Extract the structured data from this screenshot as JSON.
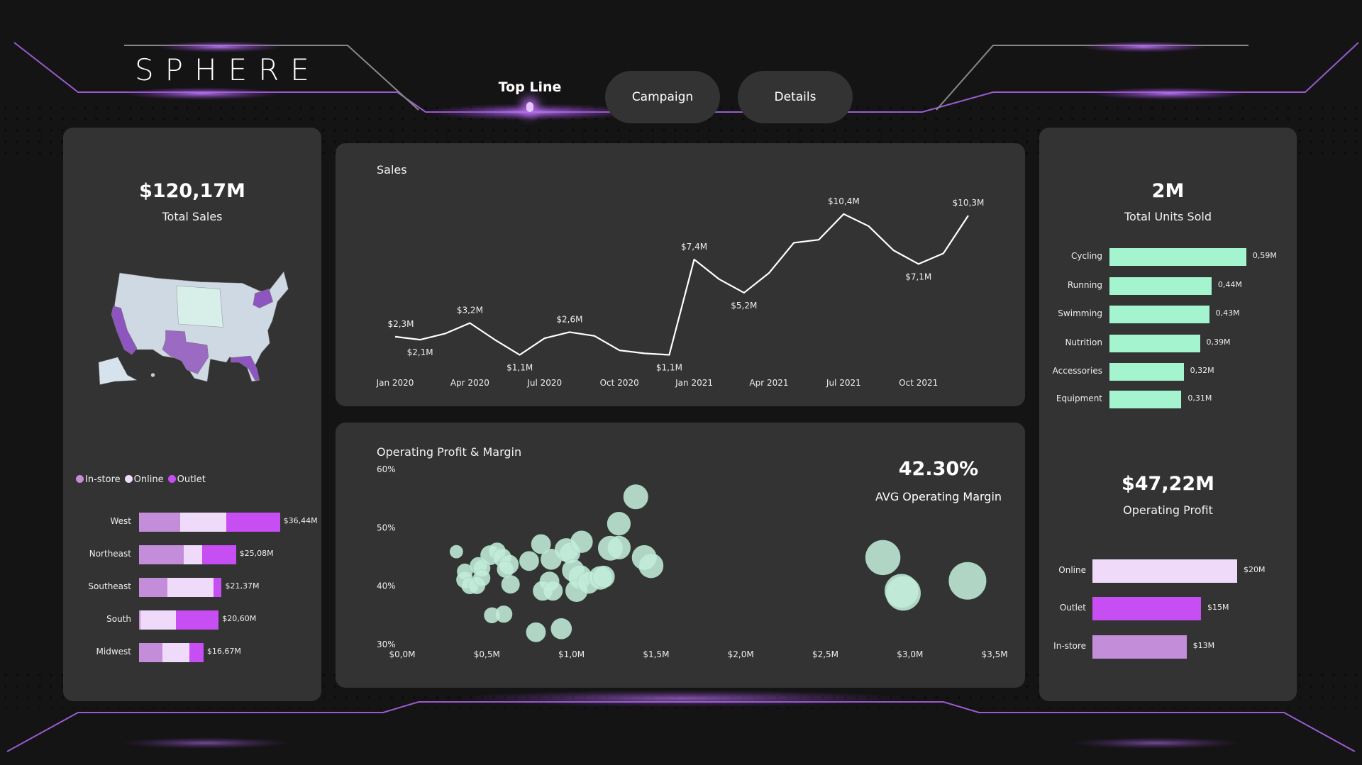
{
  "header": {
    "logo": "SPHERE",
    "tabs": [
      {
        "label": "Top Line",
        "active": true
      },
      {
        "label": "Campaign",
        "active": false
      },
      {
        "label": "Details",
        "active": false
      }
    ]
  },
  "colors": {
    "instore": "#c38dd9",
    "online": "#f0dafa",
    "outlet": "#c74ef2",
    "mint": "#a4f4cf",
    "bubble": "#c2ecd9",
    "purple_state": "#8c55c0"
  },
  "left": {
    "kpi_value": "$120,17M",
    "kpi_label": "Total Sales",
    "legend": [
      "In-store",
      "Online",
      "Outlet"
    ],
    "regions": [
      {
        "name": "West",
        "instore": 10.64,
        "online": 11.92,
        "outlet": 13.88,
        "total_label": "$36,44M"
      },
      {
        "name": "Northeast",
        "instore": 11.62,
        "online": 4.65,
        "outlet": 8.81,
        "total_label": "$25,08M"
      },
      {
        "name": "Southeast",
        "instore": 7.28,
        "online": 12.05,
        "outlet": 2.04,
        "total_label": "$21,37M"
      },
      {
        "name": "South",
        "instore": 0.31,
        "online": 9.23,
        "outlet": 11.06,
        "total_label": "$20,60M"
      },
      {
        "name": "Midwest",
        "instore": 5.99,
        "online": 7.09,
        "outlet": 3.59,
        "total_label": "$16,67M"
      }
    ]
  },
  "chart_data": [
    {
      "type": "line",
      "title": "Sales",
      "x": [
        "Jan 2020",
        "Feb 2020",
        "Mar 2020",
        "Apr 2020",
        "May 2020",
        "Jun 2020",
        "Jul 2020",
        "Aug 2020",
        "Sep 2020",
        "Oct 2020",
        "Nov 2020",
        "Dec 2020",
        "Jan 2021",
        "Feb 2021",
        "Mar 2021",
        "Apr 2021",
        "May 2021",
        "Jun 2021",
        "Jul 2021",
        "Aug 2021",
        "Sep 2021",
        "Oct 2021",
        "Nov 2021",
        "Dec 2021"
      ],
      "values": [
        2.3,
        2.1,
        2.5,
        3.2,
        2.1,
        1.1,
        2.2,
        2.6,
        2.35,
        1.4,
        1.2,
        1.1,
        7.4,
        6.1,
        5.2,
        6.5,
        8.5,
        8.7,
        10.4,
        9.6,
        8.0,
        7.1,
        7.8,
        10.3
      ],
      "unit": "$M",
      "x_ticks": [
        "Jan 2020",
        "Apr 2020",
        "Jul 2020",
        "Oct 2020",
        "Jan 2021",
        "Apr 2021",
        "Jul 2021",
        "Oct 2021"
      ],
      "data_labels": [
        {
          "index": 0,
          "text": "$2,3M",
          "pos": "above"
        },
        {
          "index": 1,
          "text": "$2,1M",
          "pos": "below"
        },
        {
          "index": 3,
          "text": "$3,2M",
          "pos": "above"
        },
        {
          "index": 5,
          "text": "$1,1M",
          "pos": "below"
        },
        {
          "index": 7,
          "text": "$2,6M",
          "pos": "above"
        },
        {
          "index": 11,
          "text": "$1,1M",
          "pos": "below"
        },
        {
          "index": 12,
          "text": "$7,4M",
          "pos": "above"
        },
        {
          "index": 14,
          "text": "$5,2M",
          "pos": "below"
        },
        {
          "index": 18,
          "text": "$10,4M",
          "pos": "above"
        },
        {
          "index": 21,
          "text": "$7,1M",
          "pos": "below"
        },
        {
          "index": 23,
          "text": "$10,3M",
          "pos": "above"
        }
      ],
      "ylim": [
        0,
        11
      ]
    },
    {
      "type": "scatter",
      "title": "Operating Profit & Margin",
      "xlabel": "",
      "ylabel": "",
      "xlim": [
        0,
        3.5
      ],
      "ylim": [
        30,
        60
      ],
      "x_ticks": [
        "$0,0M",
        "$0,5M",
        "$1,0M",
        "$1,5M",
        "$2,0M",
        "$2,5M",
        "$3,0M",
        "$3,5M"
      ],
      "y_ticks": [
        "60%",
        "50%",
        "40%",
        "30%"
      ],
      "points": [
        {
          "x": 0.32,
          "y": 45.9,
          "s": 1
        },
        {
          "x": 0.37,
          "y": 42.5,
          "s": 1.2
        },
        {
          "x": 0.37,
          "y": 41.1,
          "s": 1.3
        },
        {
          "x": 0.4,
          "y": 40.1,
          "s": 1.3
        },
        {
          "x": 0.44,
          "y": 40.1,
          "s": 1.3
        },
        {
          "x": 0.45,
          "y": 43.5,
          "s": 1.3
        },
        {
          "x": 0.47,
          "y": 43.1,
          "s": 1.3
        },
        {
          "x": 0.47,
          "y": 41.4,
          "s": 1.3
        },
        {
          "x": 0.52,
          "y": 45.3,
          "s": 1.5
        },
        {
          "x": 0.56,
          "y": 46.0,
          "s": 1.3
        },
        {
          "x": 0.59,
          "y": 44.9,
          "s": 1.4
        },
        {
          "x": 0.63,
          "y": 43.7,
          "s": 1.5
        },
        {
          "x": 0.61,
          "y": 42.9,
          "s": 1.3
        },
        {
          "x": 0.64,
          "y": 40.3,
          "s": 1.4
        },
        {
          "x": 0.53,
          "y": 35.0,
          "s": 1.2
        },
        {
          "x": 0.6,
          "y": 35.2,
          "s": 1.3
        },
        {
          "x": 0.75,
          "y": 44.3,
          "s": 1.5
        },
        {
          "x": 0.82,
          "y": 47.2,
          "s": 1.5
        },
        {
          "x": 0.88,
          "y": 44.6,
          "s": 1.6
        },
        {
          "x": 0.87,
          "y": 40.8,
          "s": 1.5
        },
        {
          "x": 0.83,
          "y": 39.2,
          "s": 1.5
        },
        {
          "x": 0.89,
          "y": 39.2,
          "s": 1.5
        },
        {
          "x": 0.79,
          "y": 32.1,
          "s": 1.5
        },
        {
          "x": 0.94,
          "y": 32.7,
          "s": 1.6
        },
        {
          "x": 0.97,
          "y": 46.2,
          "s": 1.8
        },
        {
          "x": 0.99,
          "y": 45.7,
          "s": 1.6
        },
        {
          "x": 1.01,
          "y": 42.7,
          "s": 1.7
        },
        {
          "x": 1.06,
          "y": 47.6,
          "s": 1.7
        },
        {
          "x": 1.05,
          "y": 41.6,
          "s": 1.8
        },
        {
          "x": 1.03,
          "y": 39.2,
          "s": 1.7
        },
        {
          "x": 1.1,
          "y": 40.6,
          "s": 1.7
        },
        {
          "x": 1.17,
          "y": 41.4,
          "s": 1.8
        },
        {
          "x": 1.19,
          "y": 41.6,
          "s": 1.7
        },
        {
          "x": 1.23,
          "y": 46.5,
          "s": 1.9
        },
        {
          "x": 1.28,
          "y": 46.6,
          "s": 1.8
        },
        {
          "x": 1.28,
          "y": 50.7,
          "s": 1.8
        },
        {
          "x": 1.38,
          "y": 55.3,
          "s": 1.9
        },
        {
          "x": 1.43,
          "y": 44.9,
          "s": 1.9
        },
        {
          "x": 1.47,
          "y": 43.5,
          "s": 1.9
        },
        {
          "x": 2.84,
          "y": 44.9,
          "s": 2.7
        },
        {
          "x": 2.95,
          "y": 39.2,
          "s": 2.6
        },
        {
          "x": 2.96,
          "y": 38.8,
          "s": 2.7
        },
        {
          "x": 3.34,
          "y": 40.9,
          "s": 2.9
        }
      ]
    },
    {
      "type": "bar",
      "title": "Total Units Sold by Category",
      "categories": [
        "Cycling",
        "Running",
        "Swimming",
        "Nutrition",
        "Accessories",
        "Equipment"
      ],
      "values": [
        0.59,
        0.44,
        0.43,
        0.39,
        0.32,
        0.31
      ],
      "labels": [
        "0,59M",
        "0,44M",
        "0,43M",
        "0,39M",
        "0,32M",
        "0,31M"
      ]
    },
    {
      "type": "bar",
      "title": "Operating Profit by Channel",
      "categories": [
        "Online",
        "Outlet",
        "In-store"
      ],
      "values": [
        20,
        15,
        13
      ],
      "labels": [
        "$20M",
        "$15M",
        "$13M"
      ]
    }
  ],
  "op": {
    "avg_value": "42.30%",
    "avg_label": "AVG Operating Margin"
  },
  "right": {
    "units_value": "2M",
    "units_label": "Total Units Sold",
    "profit_value": "$47,22M",
    "profit_label": "Operating Profit"
  }
}
